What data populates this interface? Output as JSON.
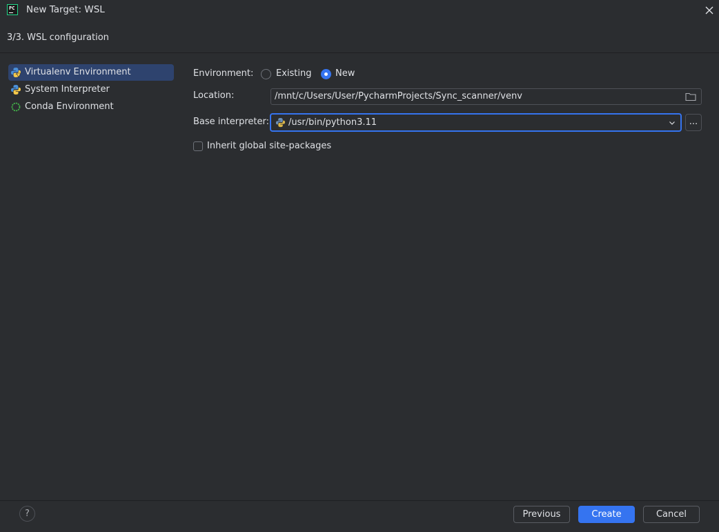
{
  "window": {
    "title": "New Target: WSL",
    "logo_text": "PC"
  },
  "step": {
    "header": "3/3. WSL configuration"
  },
  "sidebar": {
    "items": [
      {
        "label": "Virtualenv Environment",
        "icon": "virtualenv-icon",
        "selected": true
      },
      {
        "label": "System Interpreter",
        "icon": "python-icon",
        "selected": false
      },
      {
        "label": "Conda Environment",
        "icon": "conda-icon",
        "selected": false
      }
    ]
  },
  "form": {
    "environment_label": "Environment:",
    "environment_options": [
      {
        "label": "Existing",
        "checked": false
      },
      {
        "label": "New",
        "checked": true
      }
    ],
    "location_label": "Location:",
    "location_value": "/mnt/c/Users/User/PycharmProjects/Sync_scanner/venv",
    "base_interpreter_label": "Base interpreter:",
    "base_interpreter_value": "/usr/bin/python3.11",
    "browse_label": "...",
    "inherit_label": "Inherit global site-packages",
    "inherit_checked": false
  },
  "footer": {
    "help_label": "?",
    "previous_label": "Previous",
    "create_label": "Create",
    "cancel_label": "Cancel"
  },
  "colors": {
    "background": "#2b2d30",
    "accent": "#3574f0",
    "selection": "#2e436e"
  }
}
